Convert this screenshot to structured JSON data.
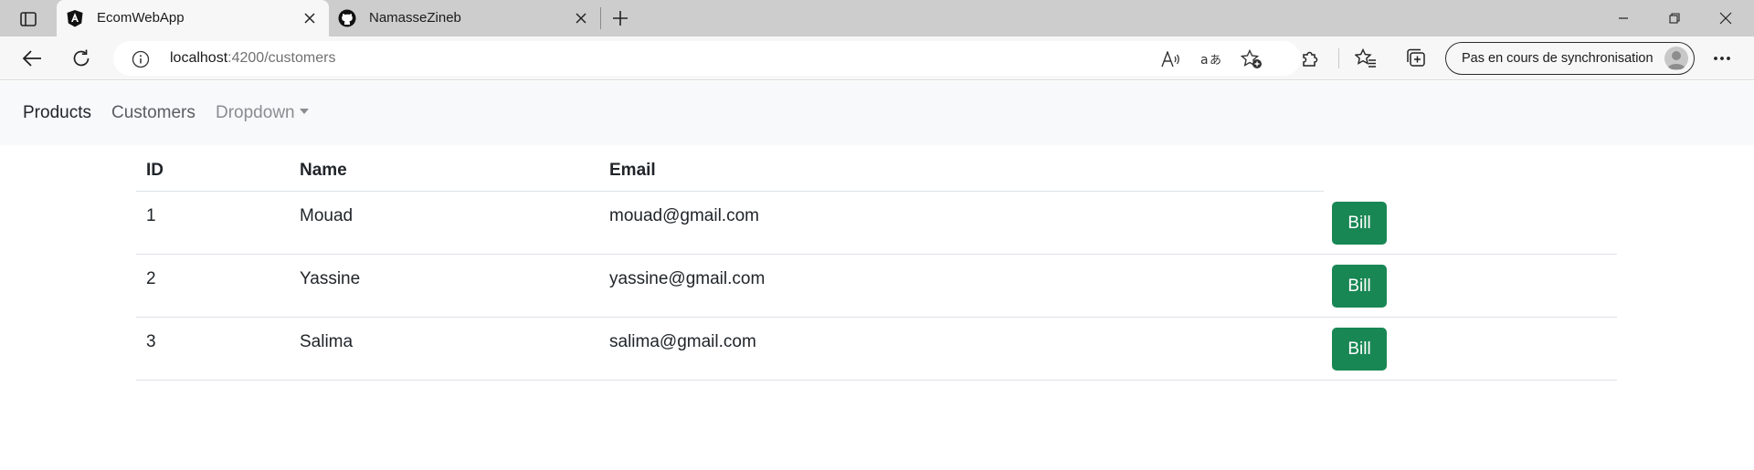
{
  "browser": {
    "tabs": [
      {
        "title": "EcomWebApp",
        "icon": "angular-icon",
        "active": true
      },
      {
        "title": "NamasseZineb",
        "icon": "github-icon",
        "active": false
      }
    ],
    "address": {
      "host": "localhost",
      "path": ":4200/customers"
    },
    "sync_label": "Pas en cours de synchronisation"
  },
  "navbar": {
    "links": [
      "Products",
      "Customers"
    ],
    "dropdown_label": "Dropdown"
  },
  "table": {
    "headers": {
      "id": "ID",
      "name": "Name",
      "email": "Email"
    },
    "rows": [
      {
        "id": "1",
        "name": "Mouad",
        "email": "mouad@gmail.com",
        "action": "Bill"
      },
      {
        "id": "2",
        "name": "Yassine",
        "email": "yassine@gmail.com",
        "action": "Bill"
      },
      {
        "id": "3",
        "name": "Salima",
        "email": "salima@gmail.com",
        "action": "Bill"
      }
    ]
  },
  "colors": {
    "accent": "#198754",
    "navbar_bg": "#f8f9fa",
    "tabbar_bg": "#cdcdcd"
  }
}
